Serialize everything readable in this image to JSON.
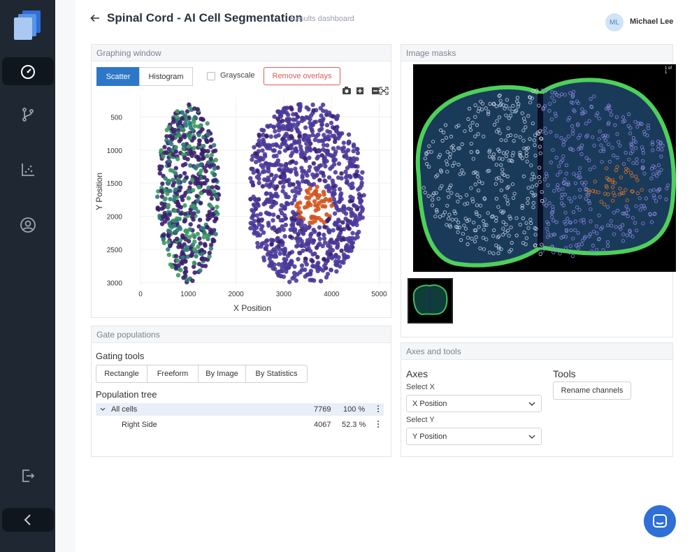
{
  "app": {
    "title": "Spinal Cord - AI Cell Segmentation",
    "subtitle": "Results dashboard"
  },
  "user": {
    "initials": "ML",
    "name": "Michael Lee"
  },
  "sidebar": {
    "items": [
      "dashboard-icon",
      "branch-icon",
      "scatter-plot-icon",
      "account-icon"
    ],
    "footer": "export-icon",
    "collapse": "chevron-left-icon"
  },
  "graphing": {
    "title": "Graphing window",
    "tabs": [
      "Scatter",
      "Histogram"
    ],
    "active_tab": "Scatter",
    "grayscale_label": "Grayscale",
    "remove_label": "Remove overlays",
    "tools": [
      "camera-icon",
      "plus-icon",
      "minus-icon",
      "fit-icon"
    ]
  },
  "chart_data": {
    "type": "scatter",
    "xlabel": "X Position",
    "ylabel": "Y Position",
    "xticks": [
      0,
      1000,
      2000,
      3000,
      4000,
      5000
    ],
    "yticks": [
      500,
      1000,
      1500,
      2000,
      2500,
      3000
    ],
    "xlim": [
      0,
      5300
    ],
    "ylim": [
      3050,
      200
    ],
    "series": [
      {
        "color": "#3b1f6e"
      },
      {
        "color": "#4a3a9a"
      },
      {
        "color": "#2d7a78"
      },
      {
        "color": "#3c9a5a"
      },
      {
        "color": "#d4541e"
      }
    ]
  },
  "image_masks": {
    "title": "Image masks",
    "page": "1 of 1"
  },
  "gate": {
    "title": "Gate populations",
    "tools_label": "Gating tools",
    "tools": [
      "Rectangle",
      "Freeform",
      "By Image",
      "By Statistics"
    ],
    "tree_label": "Population tree",
    "rows": [
      {
        "name": "All cells",
        "count": "7769",
        "pct": "100 %"
      },
      {
        "name": "Right Side",
        "count": "4067",
        "pct": "52.3 %"
      }
    ]
  },
  "axes": {
    "title": "Axes and tools",
    "axes_label": "Axes",
    "select_x_label": "Select X",
    "x_value": "X Position",
    "select_y_label": "Select Y",
    "y_value": "Y Position",
    "tools_label": "Tools",
    "rename_label": "Rename channels"
  }
}
